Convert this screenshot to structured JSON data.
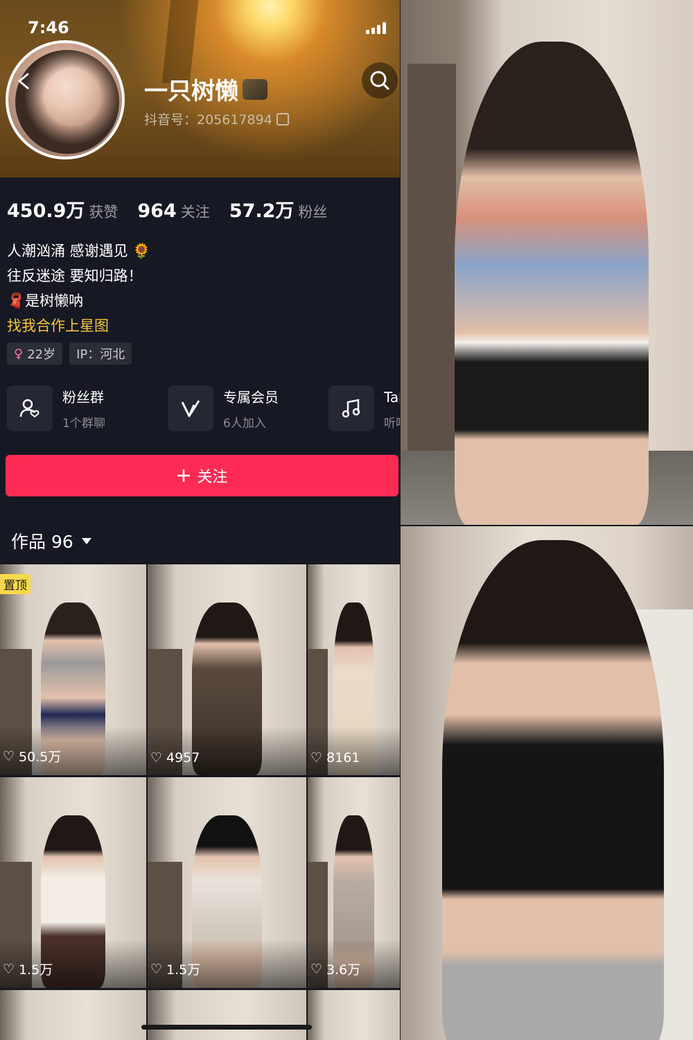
{
  "status_bar": {
    "time": "7:46"
  },
  "profile": {
    "name": "一只树懒",
    "douyin_id": "抖音号：205617894",
    "stats": [
      {
        "value": "450.9万",
        "label": "获赞"
      },
      {
        "value": "964",
        "label": "关注"
      },
      {
        "value": "57.2万",
        "label": "粉丝"
      }
    ],
    "bio": [
      "人潮汹涌 感谢遇见 🌻",
      "往反迷途 要知归路！",
      "🧣是树懒呐"
    ],
    "star_link": "找我合作上星图",
    "tags": {
      "age": "22岁",
      "ip": "IP：河北"
    }
  },
  "features": [
    {
      "icon": "fan-group-icon",
      "title": "粉丝群",
      "subtitle": "1个群聊"
    },
    {
      "icon": "membership-icon",
      "title": "专属会员",
      "subtitle": "6人加入"
    },
    {
      "icon": "music-icon",
      "title": "Ta的",
      "subtitle": "听听t"
    }
  ],
  "follow_button": {
    "label": "关注"
  },
  "works": {
    "label": "作品 96"
  },
  "videos": [
    {
      "likes": "50.5万",
      "pinned_label": "置顶"
    },
    {
      "likes": "4957"
    },
    {
      "likes": "8161"
    },
    {
      "likes": "1.5万"
    },
    {
      "likes": "1.5万"
    },
    {
      "likes": "3.6万"
    }
  ],
  "colors": {
    "accent": "#fe2c55",
    "background": "#161823",
    "star_link": "#f5c542",
    "pin_badge": "#f8d84a"
  }
}
